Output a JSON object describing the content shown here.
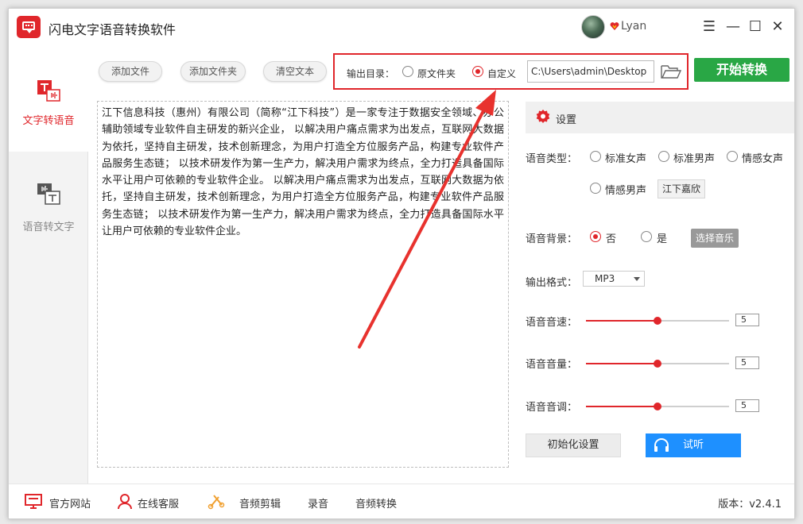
{
  "app": {
    "title": "闪电文字语音转换软件",
    "user": "Lyan",
    "version_label": "版本：",
    "version": "v2.4.1"
  },
  "sidebar": {
    "items": [
      {
        "label": "文字转语音",
        "active": true,
        "icon": "text-to-speech-icon"
      },
      {
        "label": "语音转文字",
        "active": false,
        "icon": "speech-to-text-icon"
      }
    ]
  },
  "toolbar": {
    "add_file": "添加文件",
    "add_folder": "添加文件夹",
    "clear_text": "清空文本",
    "output_label": "输出目录：",
    "radio_original": "原文件夹",
    "radio_custom": "自定义",
    "selected_output": "自定义",
    "path_value": "C:\\Users\\admin\\Desktop",
    "start": "开始转换"
  },
  "content": {
    "text": "江下信息科技（惠州）有限公司（简称“江下科技”）是一家专注于数据安全领域、办公辅助领域专业软件自主研发的新兴企业， 以解决用户痛点需求为出发点，互联网大数据为依托，坚持自主研发，技术创新理念，为用户打造全方位服务产品，构建专业软件产品服务生态链； 以技术研发作为第一生产力，解决用户需求为终点，全力打造具备国际水平让用户可依赖的专业软件企业。 以解决用户痛点需求为出发点，互联网大数据为依托，坚持自主研发，技术创新理念，为用户打造全方位服务产品，构建专业软件产品服务生态链； 以技术研发作为第一生产力，解决用户需求为终点，全力打造具备国际水平让用户可依赖的专业软件企业。"
  },
  "settings": {
    "title": "设置",
    "voice_type_label": "语音类型：",
    "voices": [
      "标准女声",
      "标准男声",
      "情感女声",
      "情感男声"
    ],
    "voice_extra_button": "江下嘉欣",
    "bg_label": "语音背景：",
    "bg_no": "否",
    "bg_yes": "是",
    "bg_selected": "否",
    "choose_music": "选择音乐",
    "format_label": "输出格式：",
    "format_value": "MP3",
    "speed_label": "语音音速：",
    "speed_value": "5",
    "volume_label": "语音音量：",
    "volume_value": "5",
    "pitch_label": "语音音调：",
    "pitch_value": "5",
    "slider_level": 0.5,
    "init_button": "初始化设置",
    "listen_button": "试听"
  },
  "footer": {
    "website": "官方网站",
    "support": "在线客服",
    "audio_edit": "音频剪辑",
    "record": "录音",
    "audio_convert": "音频转换"
  },
  "colors": {
    "accent": "#e0262b",
    "start": "#29a745",
    "listen": "#1e90ff"
  }
}
